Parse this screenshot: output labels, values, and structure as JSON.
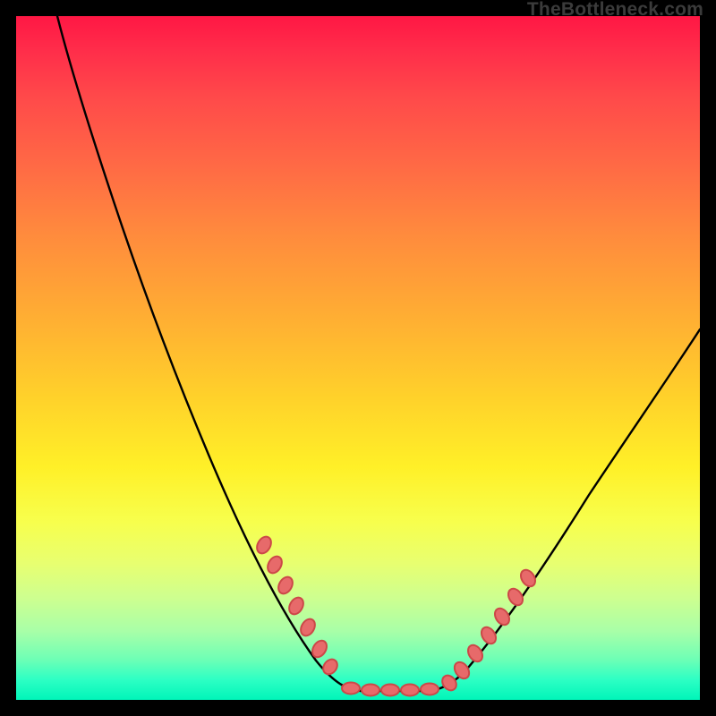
{
  "watermark": "TheBottleneck.com",
  "colors": {
    "page_bg": "#000000",
    "curve_stroke": "#000000",
    "marker_fill": "#e76a6a",
    "marker_stroke": "#cc4848",
    "gradient_top": "#ff1744",
    "gradient_mid": "#ffd22a",
    "gradient_bottom": "#00f5b9"
  },
  "chart_data": {
    "type": "line",
    "title": "",
    "xlabel": "",
    "ylabel": "",
    "xlim": [
      0,
      100
    ],
    "ylim": [
      0,
      100
    ],
    "note": "Axes are implicit (no tick labels shown). Curve is a V-shaped bottleneck profile: high on the left, dips to a floor between x≈47 and x≈62, then rises on the right. Values below are relative percentages where 0 = bottom (green) and 100 = top (red).",
    "x": [
      6,
      9,
      12,
      15,
      18,
      21,
      24,
      27,
      30,
      33,
      36,
      39,
      41,
      43,
      45,
      47,
      49,
      52,
      55,
      58,
      60,
      62,
      65,
      68,
      71,
      75,
      80,
      85,
      90,
      95,
      100
    ],
    "y": [
      100,
      92,
      84,
      76,
      68,
      60,
      52,
      45,
      38,
      31,
      25,
      19,
      14,
      10,
      6,
      3,
      1.2,
      0.8,
      0.8,
      0.8,
      1.5,
      3,
      6,
      10,
      15,
      22,
      31,
      40,
      48,
      55,
      60
    ],
    "series": [
      {
        "name": "bottleneck-curve",
        "x": [
          6,
          9,
          12,
          15,
          18,
          21,
          24,
          27,
          30,
          33,
          36,
          39,
          41,
          43,
          45,
          47,
          49,
          52,
          55,
          58,
          60,
          62,
          65,
          68,
          71,
          75,
          80,
          85,
          90,
          95,
          100
        ],
        "y": [
          100,
          92,
          84,
          76,
          68,
          60,
          52,
          45,
          38,
          31,
          25,
          19,
          14,
          10,
          6,
          3,
          1.2,
          0.8,
          0.8,
          0.8,
          1.5,
          3,
          6,
          10,
          15,
          22,
          31,
          40,
          48,
          55,
          60
        ]
      }
    ],
    "markers": {
      "note": "Pink dash/dot segments overlaid on the curve near the trough and its shoulders.",
      "left_shoulder": {
        "x_range": [
          36,
          46
        ],
        "y_range": [
          25,
          4
        ]
      },
      "floor": {
        "x_range": [
          47,
          62
        ],
        "y_range": [
          1,
          3
        ]
      },
      "right_shoulder": {
        "x_range": [
          62,
          71
        ],
        "y_range": [
          3,
          16
        ]
      }
    }
  }
}
